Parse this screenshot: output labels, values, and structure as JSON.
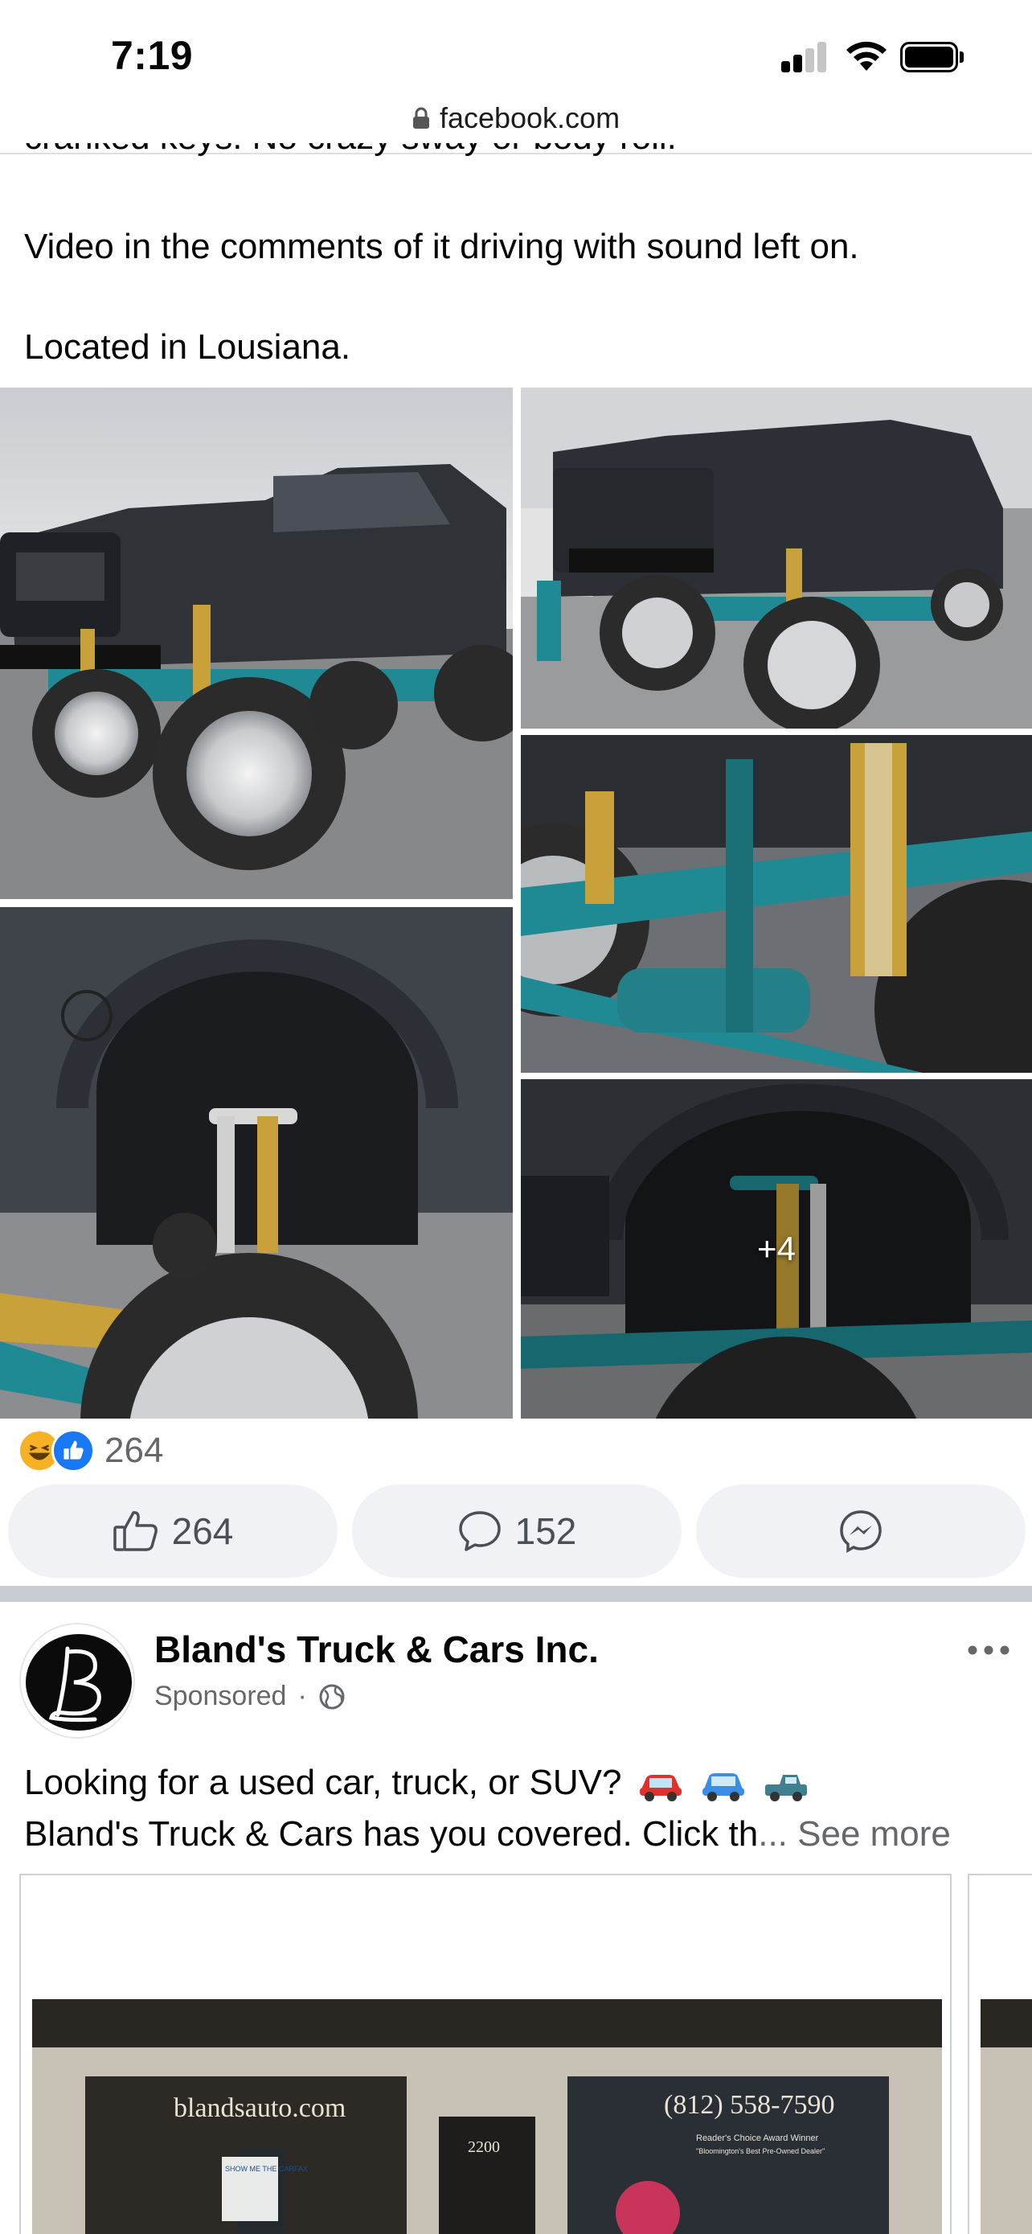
{
  "status_bar": {
    "time": "7:19"
  },
  "browser": {
    "url": "facebook.com"
  },
  "post": {
    "cut_text": "cranked keys. No crazy sway or body roll.",
    "line_video": "Video in the comments of it driving with sound left on.",
    "line_location": "Located in Lousiana.",
    "photos": [
      {
        "name": "truck-front-photo"
      },
      {
        "name": "truck-rear-photo"
      },
      {
        "name": "suspension-closeup-photo"
      },
      {
        "name": "wheel-well-photo"
      },
      {
        "name": "front-wheel-well-photo",
        "overlay": "+4"
      }
    ],
    "reactions": {
      "icons": [
        "haha-icon",
        "like-icon"
      ],
      "count": "264"
    },
    "actions": {
      "like_count": "264",
      "comment_count": "152"
    }
  },
  "sponsored_post": {
    "page_name": "Bland's Truck & Cars Inc.",
    "sponsored_label": "Sponsored",
    "separator": "·",
    "line1": "Looking for a used car, truck, or SUV?",
    "line2": "Bland's Truck & Cars has you covered. Click th",
    "ellipsis": "...",
    "see_more": "See more",
    "ad_image": {
      "website": "blandsauto.com",
      "phone": "(812) 558-7590",
      "address_number": "2200",
      "badge": "SHOW ME THE CARFAX",
      "award_title": "Reader's Choice Award Winner",
      "award_sub": "\"Bloomington's Best Pre-Owned Dealer\""
    }
  },
  "colors": {
    "facebook_blue": "#1877f2",
    "text_secondary": "#65676b",
    "button_bg": "#f0f2f5",
    "truck_teal": "#1f8a93",
    "coilover_gold": "#c9a13a"
  }
}
